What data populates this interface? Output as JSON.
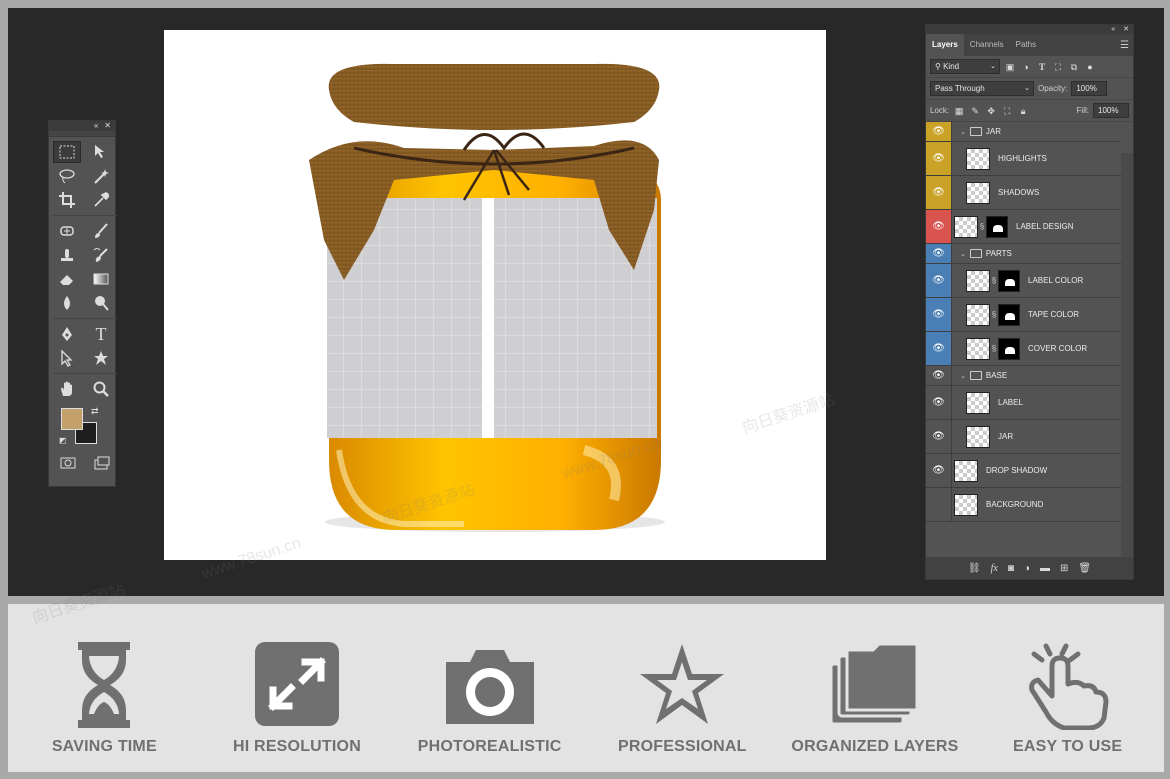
{
  "tools_panel": {
    "collapse_glyph": "«",
    "close_glyph": "✕",
    "tools": [
      "marquee-tool",
      "move-tool",
      "lasso-tool",
      "magic-wand-tool",
      "crop-tool",
      "eyedropper-tool",
      "healing-tool",
      "brush-tool",
      "clone-stamp-tool",
      "history-brush-tool",
      "eraser-tool",
      "gradient-tool",
      "blur-tool",
      "dodge-tool",
      "pen-tool",
      "type-tool",
      "path-selection-tool",
      "shape-tool",
      "hand-tool",
      "zoom-tool"
    ],
    "type_tool_glyph": "T",
    "foreground_color": "#c4a06a",
    "background_color": "#1f1f1f"
  },
  "layers_panel": {
    "collapse_glyph": "«",
    "close_glyph": "✕",
    "tabs": [
      "Layers",
      "Channels",
      "Paths"
    ],
    "filter_kind": "Kind",
    "blend_mode": "Pass Through",
    "opacity_label": "Opacity:",
    "opacity_value": "100%",
    "lock_label": "Lock:",
    "fill_label": "Fill:",
    "fill_value": "100%",
    "layers": [
      {
        "name": "JAR",
        "kind": "group",
        "indent": 0,
        "color": "#c9a227"
      },
      {
        "name": "HIGHLIGHTS",
        "kind": "layer",
        "indent": 1,
        "color": "#c9a227",
        "mask": false
      },
      {
        "name": "SHADOWS",
        "kind": "layer",
        "indent": 1,
        "color": "#c9a227",
        "mask": false
      },
      {
        "name": "LABEL DESIGN",
        "kind": "smart",
        "indent": 0,
        "color": "#d9534f",
        "mask": true
      },
      {
        "name": "PARTS",
        "kind": "group",
        "indent": 0,
        "color": "#4a7fb5"
      },
      {
        "name": "LABEL COLOR",
        "kind": "fill",
        "indent": 1,
        "color": "#4a7fb5",
        "mask": true
      },
      {
        "name": "TAPE COLOR",
        "kind": "fill",
        "indent": 1,
        "color": "#4a7fb5",
        "mask": true
      },
      {
        "name": "COVER COLOR",
        "kind": "fill",
        "indent": 1,
        "color": "#4a7fb5",
        "mask": true
      },
      {
        "name": "BASE",
        "kind": "group",
        "indent": 0,
        "color": ""
      },
      {
        "name": "LABEL",
        "kind": "layer",
        "indent": 1,
        "color": "",
        "mask": false
      },
      {
        "name": "JAR",
        "kind": "layer",
        "indent": 1,
        "color": "",
        "mask": false
      },
      {
        "name": "DROP SHADOW",
        "kind": "layer",
        "indent": 0,
        "color": "",
        "mask": false
      },
      {
        "name": "BACKGROUND",
        "kind": "layer",
        "indent": 0,
        "color": "",
        "mask": false,
        "hidden": true
      }
    ],
    "footer_icons": [
      "link-icon",
      "fx-icon",
      "mask-icon",
      "adjustment-icon",
      "folder-icon",
      "new-layer-icon",
      "trash-icon"
    ]
  },
  "features": [
    {
      "label": "SAVING TIME",
      "icon": "hourglass-icon"
    },
    {
      "label": "HI RESOLUTION",
      "icon": "expand-icon"
    },
    {
      "label": "PHOTOREALISTIC",
      "icon": "camera-icon"
    },
    {
      "label": "PROFESSIONAL",
      "icon": "star-icon"
    },
    {
      "label": "ORGANIZED LAYERS",
      "icon": "stacked-folders-icon"
    },
    {
      "label": "EASY TO USE",
      "icon": "pointing-hand-icon"
    }
  ],
  "watermarks": [
    "向日葵资源站",
    "www.78sun.cn"
  ],
  "colors": {
    "honey": "#f2a800",
    "burlap": "#8a5e22",
    "label": "#cfcfd0"
  }
}
